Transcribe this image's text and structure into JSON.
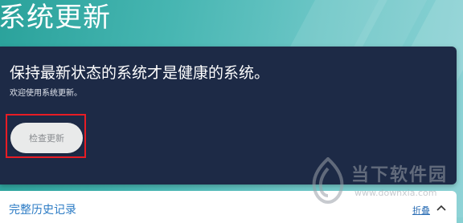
{
  "header": {
    "title": "系统更新"
  },
  "update_card": {
    "headline": "保持最新状态的系统才是健康的系统。",
    "subline": "欢迎使用系统更新。",
    "check_button_label": "检查更新"
  },
  "history": {
    "title": "完整历史记录",
    "collapse_label": "折叠"
  },
  "watermark": {
    "text": "当下软件园",
    "url": "www.downxia.com"
  },
  "colors": {
    "header_gradient_start": "#2aa29b",
    "card_background": "#1d2a46",
    "button_background": "#e9eaea",
    "highlight_border": "#e81c24",
    "link_color": "#2d7cc5"
  }
}
